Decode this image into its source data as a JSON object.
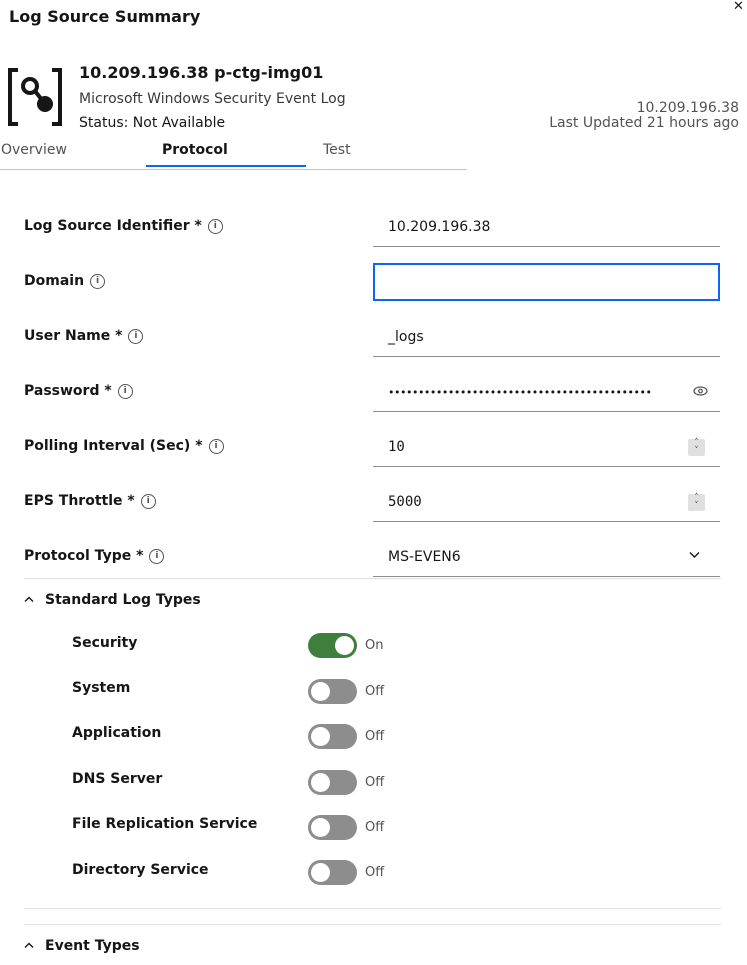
{
  "panel": {
    "title": "Log Source Summary",
    "close_icon": "close-icon"
  },
  "source": {
    "icon": "log-source-icon",
    "name": "10.209.196.38 p-ctg-img01",
    "type": "Microsoft Windows Security Event Log",
    "status": "Status: Not Available",
    "ip": "10.209.196.38",
    "last_updated": "Last Updated 21 hours ago"
  },
  "tabs": [
    {
      "label": "Overview",
      "active": false
    },
    {
      "label": "Protocol",
      "active": true
    },
    {
      "label": "Test",
      "active": false
    }
  ],
  "fields": {
    "log_source_identifier": {
      "label": "Log Source Identifier *",
      "value": "10.209.196.38"
    },
    "domain": {
      "label": "Domain",
      "value": ""
    },
    "user_name": {
      "label": "User Name *",
      "value": "_logs"
    },
    "password": {
      "label": "Password *",
      "value": "••••••••••••••••••••••••••••••••••••••••••••"
    },
    "polling_interval": {
      "label": "Polling Interval (Sec) *",
      "value": "10"
    },
    "eps_throttle": {
      "label": "EPS Throttle *",
      "value": "5000"
    },
    "protocol_type": {
      "label": "Protocol Type *",
      "value": "MS-EVEN6"
    }
  },
  "standard_log_types": {
    "title": "Standard Log Types",
    "items": [
      {
        "label": "Security",
        "state": "On",
        "on": true
      },
      {
        "label": "System",
        "state": "Off",
        "on": false
      },
      {
        "label": "Application",
        "state": "Off",
        "on": false
      },
      {
        "label": "DNS Server",
        "state": "Off",
        "on": false
      },
      {
        "label": "File Replication Service",
        "state": "Off",
        "on": false
      },
      {
        "label": "Directory Service",
        "state": "Off",
        "on": false
      }
    ]
  },
  "event_types": {
    "title": "Event Types"
  },
  "colors": {
    "accent": "#0f62fe",
    "toggle_on": "#3e7f3e",
    "toggle_off": "#8d8d8d"
  }
}
